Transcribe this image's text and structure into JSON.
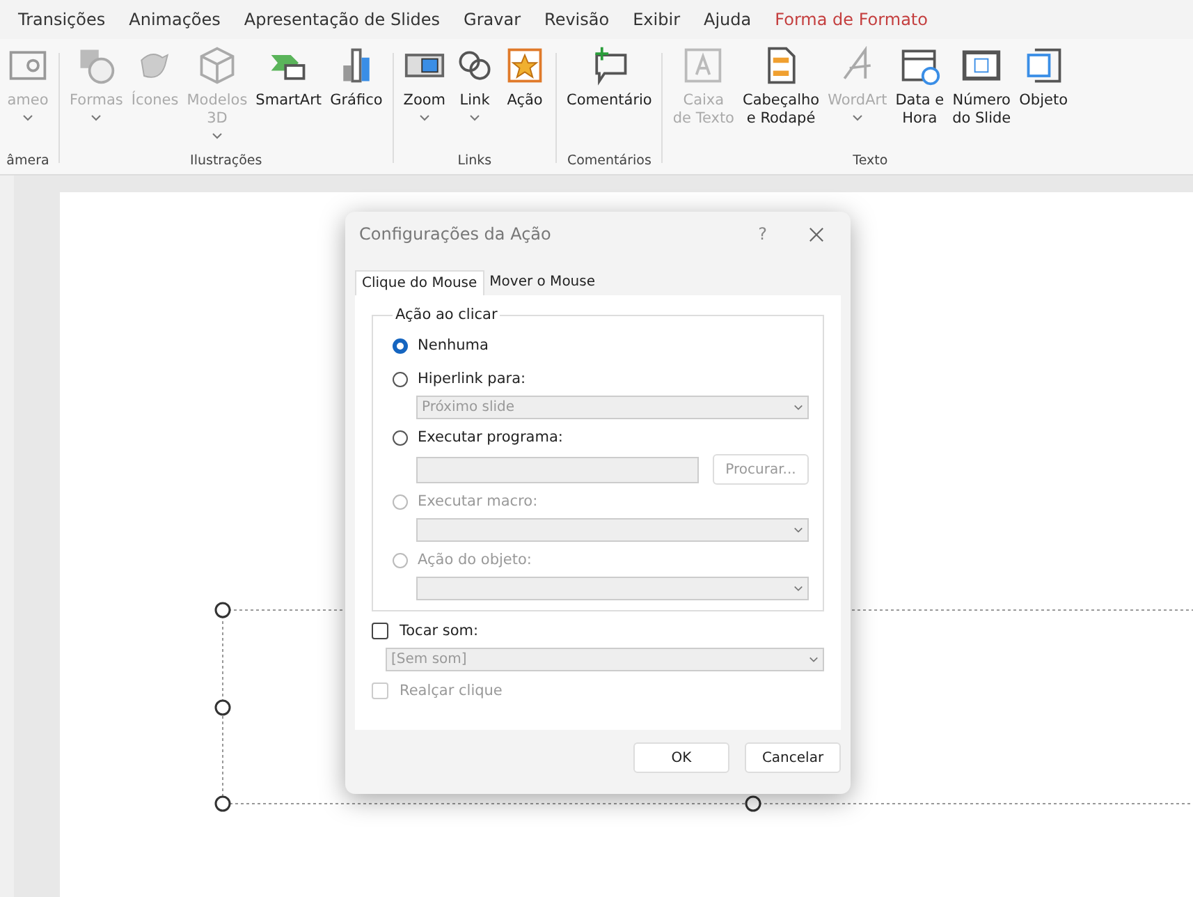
{
  "ribbon_tabs": [
    {
      "label": "Transições",
      "contextual": false
    },
    {
      "label": "Animações",
      "contextual": false
    },
    {
      "label": "Apresentação de Slides",
      "contextual": false
    },
    {
      "label": "Gravar",
      "contextual": false
    },
    {
      "label": "Revisão",
      "contextual": false
    },
    {
      "label": "Exibir",
      "contextual": false
    },
    {
      "label": "Ajuda",
      "contextual": false
    },
    {
      "label": "Forma de Formato",
      "contextual": true
    }
  ],
  "ribbon_groups": [
    {
      "label": "âmera",
      "items": [
        {
          "kind": "cameo",
          "label": "ameo",
          "disabled": true,
          "dropdown": true
        }
      ]
    },
    {
      "label": "Ilustrações",
      "items": [
        {
          "kind": "shapes",
          "label": "Formas",
          "disabled": true,
          "dropdown": true
        },
        {
          "kind": "icons",
          "label": "Ícones",
          "disabled": true,
          "dropdown": false
        },
        {
          "kind": "models",
          "label": "Modelos\n3D",
          "disabled": true,
          "dropdown": true
        },
        {
          "kind": "smartart",
          "label": "SmartArt",
          "disabled": false,
          "dropdown": false
        },
        {
          "kind": "chart",
          "label": "Gráfico",
          "disabled": false,
          "dropdown": false
        }
      ]
    },
    {
      "label": "Links",
      "items": [
        {
          "kind": "zoom",
          "label": "Zoom",
          "disabled": false,
          "dropdown": true
        },
        {
          "kind": "link",
          "label": "Link",
          "disabled": false,
          "dropdown": true
        },
        {
          "kind": "action",
          "label": "Ação",
          "disabled": false,
          "dropdown": false
        }
      ]
    },
    {
      "label": "Comentários",
      "items": [
        {
          "kind": "comment",
          "label": "Comentário",
          "disabled": false,
          "dropdown": false
        }
      ]
    },
    {
      "label": "Texto",
      "items": [
        {
          "kind": "textbox",
          "label": "Caixa\nde Texto",
          "disabled": true,
          "dropdown": false
        },
        {
          "kind": "header",
          "label": "Cabeçalho\ne Rodapé",
          "disabled": false,
          "dropdown": false
        },
        {
          "kind": "wordart",
          "label": "WordArt",
          "disabled": true,
          "dropdown": true
        },
        {
          "kind": "date",
          "label": "Data e\nHora",
          "disabled": false,
          "dropdown": false
        },
        {
          "kind": "slidenum",
          "label": "Número\ndo Slide",
          "disabled": false,
          "dropdown": false
        },
        {
          "kind": "object",
          "label": "Objeto",
          "disabled": false,
          "dropdown": false
        }
      ]
    }
  ],
  "dialog": {
    "title": "Configurações da Ação",
    "help": "?",
    "tabs": [
      {
        "label": "Clique do Mouse",
        "selected": true
      },
      {
        "label": "Mover o Mouse",
        "selected": false
      }
    ],
    "group": {
      "legend": "Ação ao clicar",
      "options": [
        {
          "label": "Nenhuma",
          "selected": true,
          "disabled": false
        },
        {
          "label": "Hiperlink para:",
          "selected": false,
          "disabled": false,
          "control": {
            "kind": "dropdown",
            "value": "Próximo slide"
          }
        },
        {
          "label": "Executar programa:",
          "selected": false,
          "disabled": false,
          "control": {
            "kind": "field",
            "button": "Procurar..."
          }
        },
        {
          "label": "Executar macro:",
          "selected": false,
          "disabled": true,
          "control": {
            "kind": "dropdown"
          }
        },
        {
          "label": "Ação do objeto:",
          "selected": false,
          "disabled": true,
          "control": {
            "kind": "dropdown"
          }
        }
      ]
    },
    "sound": {
      "label": "Tocar som:",
      "checked": false,
      "disabled": false,
      "value": "[Sem som]"
    },
    "highlight": {
      "label": "Realçar clique",
      "checked": false,
      "disabled": true
    },
    "buttons": [
      "OK",
      "Cancelar"
    ]
  }
}
